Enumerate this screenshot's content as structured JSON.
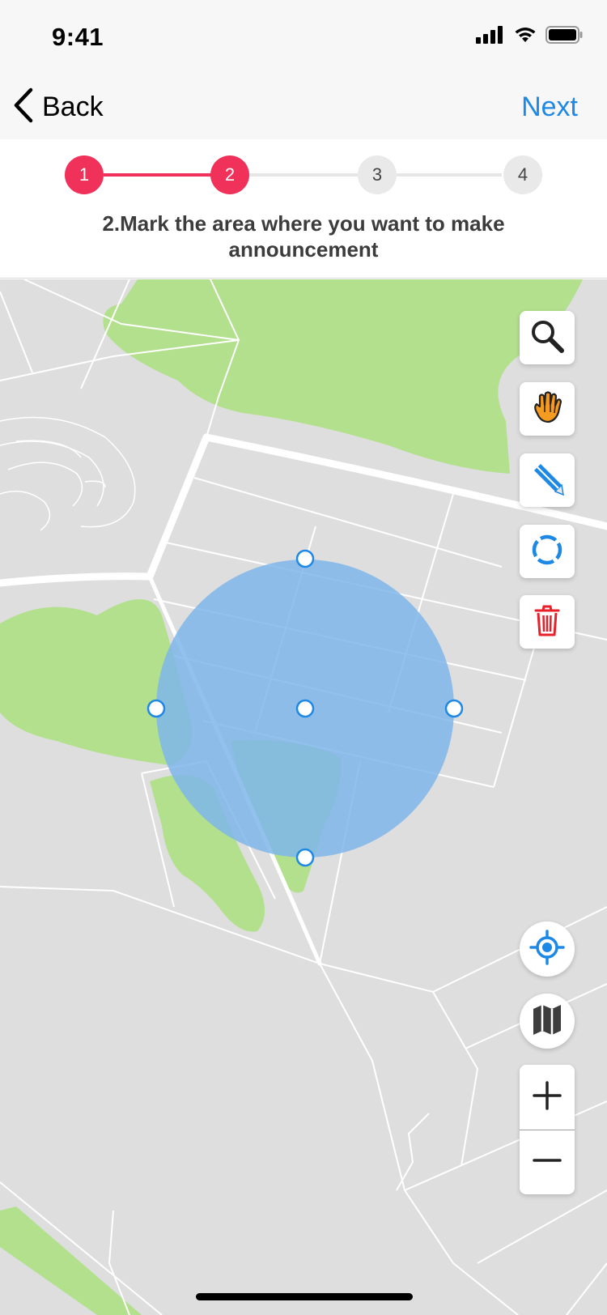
{
  "status_bar": {
    "time": "9:41",
    "icons": [
      "cellular-signal-icon",
      "wifi-icon",
      "battery-icon"
    ]
  },
  "nav": {
    "back_label": "Back",
    "next_label": "Next",
    "back_icon": "chevron-left-icon"
  },
  "stepper": {
    "steps": [
      {
        "label": "1",
        "state": "completed"
      },
      {
        "label": "2",
        "state": "current"
      },
      {
        "label": "3",
        "state": "upcoming"
      },
      {
        "label": "4",
        "state": "upcoming"
      }
    ],
    "instruction": "2.Mark the area where you want to make announcement"
  },
  "map_tools": [
    {
      "name": "search-icon"
    },
    {
      "name": "hand-pan-icon"
    },
    {
      "name": "pencil-draw-icon"
    },
    {
      "name": "circle-draw-icon"
    },
    {
      "name": "trash-icon"
    }
  ],
  "map_controls": [
    {
      "name": "my-location-icon"
    },
    {
      "name": "map-layers-icon"
    },
    {
      "name": "zoom-in-icon"
    },
    {
      "name": "zoom-out-icon"
    }
  ],
  "colors": {
    "accent": "#f0315a",
    "link": "#1e88e5",
    "selection_fill": "#7fb6ea",
    "park": "#b2e08d",
    "map_base": "#dedede",
    "trash": "#e8202a",
    "hand": "#f59b1f"
  }
}
